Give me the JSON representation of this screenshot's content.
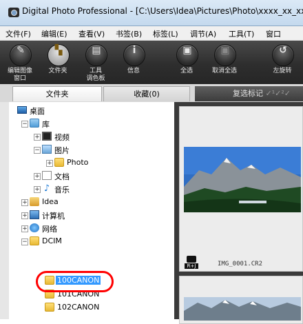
{
  "window": {
    "title": "Digital Photo Professional - [C:\\Users\\Idea\\Pictures\\Photo\\xxxx_xx_xx"
  },
  "menu": [
    "文件(F)",
    "编辑(E)",
    "查看(V)",
    "书签(B)",
    "标签(L)",
    "调节(A)",
    "工具(T)",
    "窗口"
  ],
  "toolbar": [
    {
      "label": "编辑图像\n窗口",
      "icon": "edit-image-window-icon"
    },
    {
      "label": "文件夹",
      "icon": "folder-icon"
    },
    {
      "label": "工具\n调色板",
      "icon": "tool-palette-icon"
    },
    {
      "label": "信息",
      "icon": "info-icon"
    },
    {
      "label": "全选",
      "icon": "select-all-icon"
    },
    {
      "label": "取消全选",
      "icon": "deselect-all-icon"
    },
    {
      "label": "左旋转",
      "icon": "rotate-left-icon"
    }
  ],
  "tabs": {
    "folder": "文件夹",
    "favorites": "收藏(0)"
  },
  "check_marks_label": "复选标记",
  "tree": {
    "desktop": "桌面",
    "library": "库",
    "video": "视频",
    "pictures": "图片",
    "photo": "Photo",
    "documents": "文档",
    "music": "音乐",
    "idea": "Idea",
    "computer": "计算机",
    "network": "网络",
    "dcim": "DCIM",
    "folders": [
      "100CANON",
      "101CANON",
      "102CANON"
    ]
  },
  "thumbnails": [
    {
      "filename": "IMG_0001.CR2",
      "badge": "R+J"
    }
  ],
  "colors": {
    "selection": "#3399ff",
    "annotation": "#ff0000",
    "toolbar": "#2e2e2e"
  }
}
